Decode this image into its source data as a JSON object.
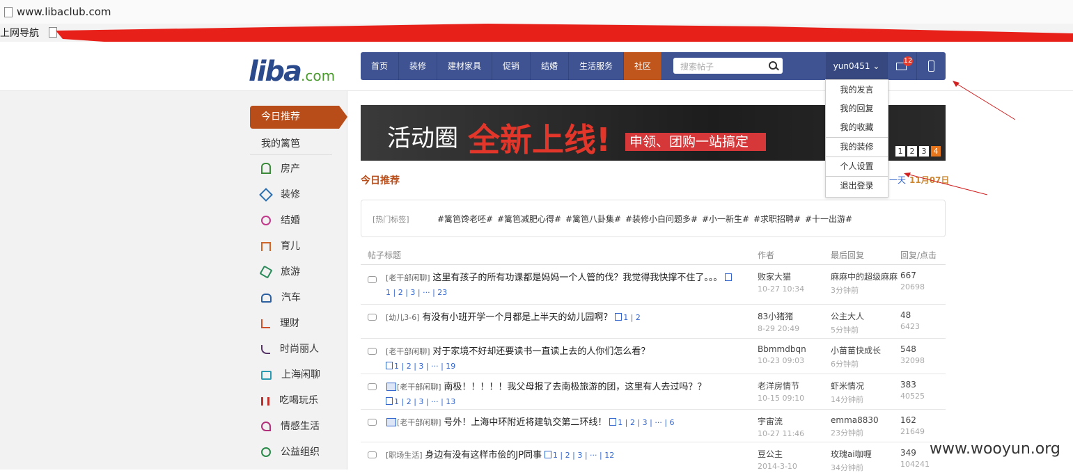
{
  "browser": {
    "url": "www.libaclub.com",
    "bookmark_label": "上网导航"
  },
  "logo": {
    "main": "liba",
    "suffix": ".com"
  },
  "nav": {
    "items": [
      "首页",
      "装修",
      "建材家具",
      "促销",
      "结婚",
      "生活服务",
      "社区"
    ],
    "active": "社区",
    "search_placeholder": "搜索帖子",
    "username": "yun0451",
    "mail_count": "12"
  },
  "user_menu": [
    "我的发言",
    "我的回复",
    "我的收藏",
    "我的装修",
    "个人设置",
    "退出登录"
  ],
  "sidebar": {
    "active": "今日推荐",
    "my": "我的篱笆",
    "items": [
      "房产",
      "装修",
      "结婚",
      "育儿",
      "旅游",
      "汽车",
      "理财",
      "时尚丽人",
      "上海闲聊",
      "吃喝玩乐",
      "情感生活",
      "公益组织"
    ]
  },
  "banner": {
    "t1": "活动圈",
    "t2": "全新上线!",
    "t3": "申领、团购一站搞定",
    "pages": [
      "1",
      "2",
      "3",
      "4"
    ],
    "active_page": "4"
  },
  "section": {
    "title": "今日推荐",
    "prev": "一天",
    "date": "11月07日"
  },
  "hot_tags": {
    "label": "[热门标签]",
    "tags": [
      "#篱笆馋老呸#",
      "#篱笆减肥心得#",
      "#篱笆八卦集#",
      "#装修小白问题多#",
      "#小一新生#",
      "#求职招聘#",
      "#十一出游#"
    ]
  },
  "table": {
    "headers": [
      "帖子标题",
      "作者",
      "最后回复",
      "回复/点击"
    ],
    "rows": [
      {
        "cat": "[老干部闲聊]",
        "title": "这里有孩子的所有功课都是妈妈一个人管的伐？我觉得我快撑不住了。。。",
        "pages": "1 | 2 | 3 | ··· | 23",
        "author": "败家大猫",
        "atime": "10-27 10:34",
        "last": "麻麻中的超级麻麻",
        "ltime": "3分钟前",
        "replies": "667",
        "clicks": "20698"
      },
      {
        "cat": "[幼儿3-6]",
        "title": "有没有小班开学一个月都是上半天的幼儿园啊？",
        "pages": "1 | 2",
        "author": "83小猪猪",
        "atime": "8-29 20:49",
        "last": "公主大人",
        "ltime": "5分钟前",
        "replies": "48",
        "clicks": "6423"
      },
      {
        "cat": "[老干部闲聊]",
        "title": "对于家境不好却还要读书一直读上去的人你们怎么看？",
        "pages": "1 | 2 | 3 | ··· | 19",
        "author": "Bbmmdbqn",
        "atime": "10-23 09:03",
        "last": "小苗苗快成长",
        "ltime": "6分钟前",
        "replies": "548",
        "clicks": "32098"
      },
      {
        "cat": "[老干部闲聊]",
        "title": "南极！！！！！我父母报了去南极旅游的团，这里有人去过吗？？",
        "pages": "1 | 2 | 3 | ··· | 13",
        "author": "老洋房情节",
        "atime": "10-15 09:10",
        "last": "虾米情况",
        "ltime": "14分钟前",
        "replies": "383",
        "clicks": "40525"
      },
      {
        "cat": "[老干部闲聊]",
        "title": "号外！上海中环附近将建轨交第二环线！",
        "pages": "1 | 2 | 3 | ··· | 6",
        "author": "宇宙流",
        "atime": "10-27 11:46",
        "last": "emma8830",
        "ltime": "23分钟前",
        "replies": "162",
        "clicks": "21649"
      },
      {
        "cat": "[职场生活]",
        "title": "身边有没有这样市侩的JP同事",
        "pages": "1 | 2 | 3 | ··· | 12",
        "author": "豆公主",
        "atime": "2014-3-10",
        "last": "玫瑰ai咖喱",
        "ltime": "34分钟前",
        "replies": "349",
        "clicks": "104241"
      }
    ]
  },
  "watermark": "www.wooyun.org"
}
